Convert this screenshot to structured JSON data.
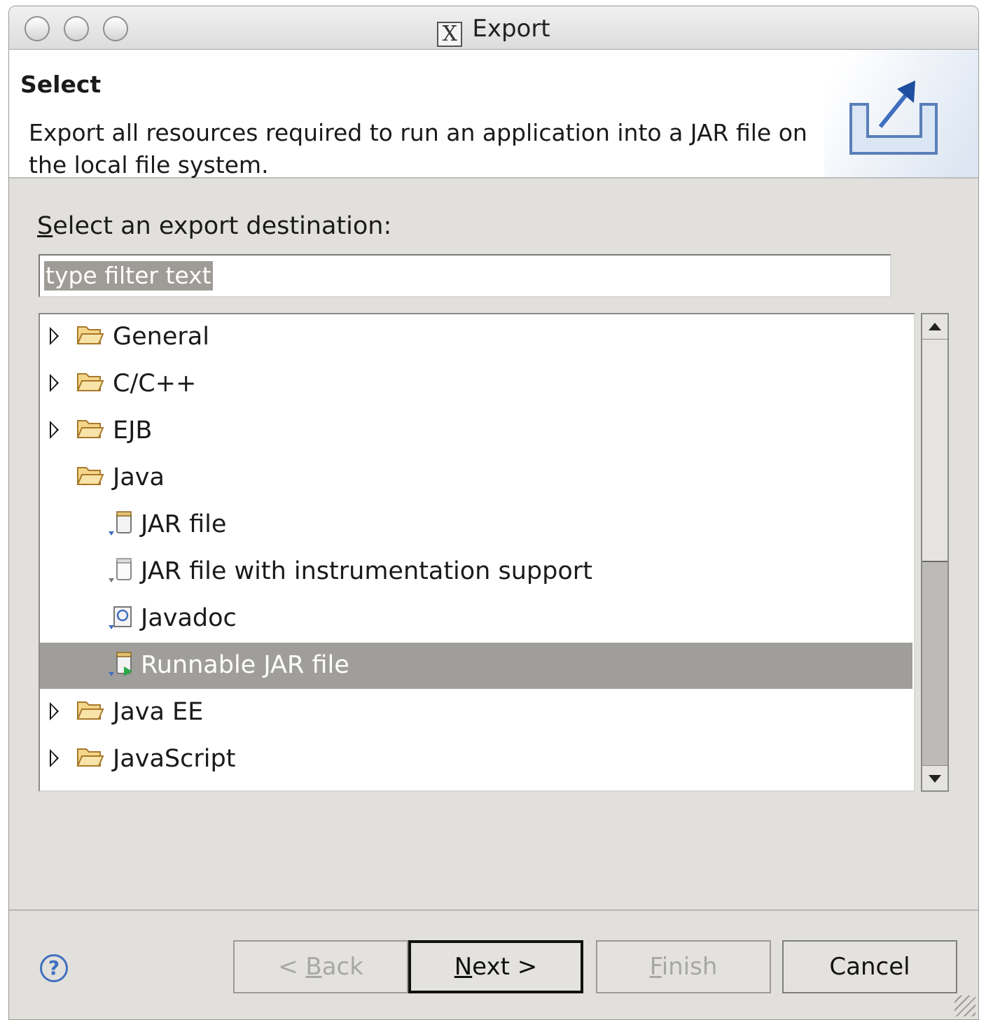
{
  "window": {
    "title": "Export",
    "title_icon": "x11-icon"
  },
  "banner": {
    "title": "Select",
    "description": "Export all resources required to run an application into a JAR file on the local file system.",
    "icon": "export-wizard-icon"
  },
  "destination": {
    "label_prefix": "",
    "label_mnemonic": "S",
    "label_rest": "elect an export destination:",
    "filter_placeholder": "type filter text"
  },
  "tree": {
    "items": [
      {
        "label": "General",
        "kind": "folder",
        "expandable": true,
        "level": 0
      },
      {
        "label": "C/C++",
        "kind": "folder",
        "expandable": true,
        "level": 0
      },
      {
        "label": "EJB",
        "kind": "folder",
        "expandable": true,
        "level": 0
      },
      {
        "label": "Java",
        "kind": "folder",
        "expandable": false,
        "level": 0
      },
      {
        "label": "JAR file",
        "kind": "jar",
        "level": 1
      },
      {
        "label": "JAR file with instrumentation support",
        "kind": "jar",
        "level": 1
      },
      {
        "label": "Javadoc",
        "kind": "javadoc",
        "level": 1
      },
      {
        "label": "Runnable JAR file",
        "kind": "runnable-jar",
        "level": 1,
        "selected": true
      },
      {
        "label": "Java EE",
        "kind": "folder",
        "expandable": true,
        "level": 0
      },
      {
        "label": "JavaScript",
        "kind": "folder",
        "expandable": true,
        "level": 0
      }
    ]
  },
  "buttons": {
    "back_pre": "< ",
    "back_mn": "B",
    "back_post": "ack",
    "next_mn": "N",
    "next_post": "ext >",
    "finish_mn": "F",
    "finish_post": "inish",
    "cancel": "Cancel",
    "help": "?"
  },
  "colors": {
    "selection": "#a09e9a",
    "window_bg": "#e2e0dc",
    "accent": "#3f6fbf"
  }
}
